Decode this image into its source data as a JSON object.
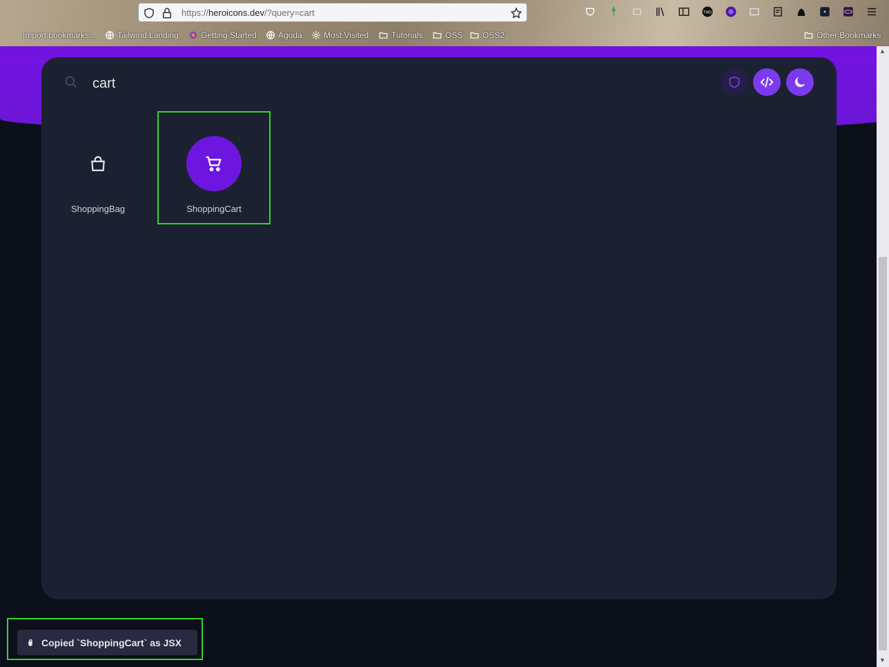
{
  "browser": {
    "url_prefix": "https://",
    "url_host": "heroicons.dev",
    "url_rest": "/?query=cart",
    "toolbar_labels": {
      "twd": "TWD"
    },
    "bookmarks": [
      {
        "label": "Import bookmarks...",
        "icon": "import-icon"
      },
      {
        "label": "Tailwind Landing",
        "icon": "globe-icon"
      },
      {
        "label": "Getting Started",
        "icon": "firefox-icon"
      },
      {
        "label": "Agoda",
        "icon": "globe-icon"
      },
      {
        "label": "Most Visited",
        "icon": "gear-icon"
      },
      {
        "label": "Tutorials",
        "icon": "folder-icon"
      },
      {
        "label": "OSS",
        "icon": "folder-icon"
      },
      {
        "label": "OSS2",
        "icon": "folder-icon"
      }
    ],
    "other_bookmarks": "Other Bookmarks"
  },
  "search": {
    "value": "cart"
  },
  "icons": [
    {
      "name": "ShoppingBag",
      "selected": false
    },
    {
      "name": "ShoppingCart",
      "selected": true
    }
  ],
  "toast": {
    "message": "Copied `ShoppingCart` as JSX"
  },
  "colors": {
    "brand": "#6d16e0",
    "panel": "#1b2130",
    "highlight": "#32d52d"
  }
}
